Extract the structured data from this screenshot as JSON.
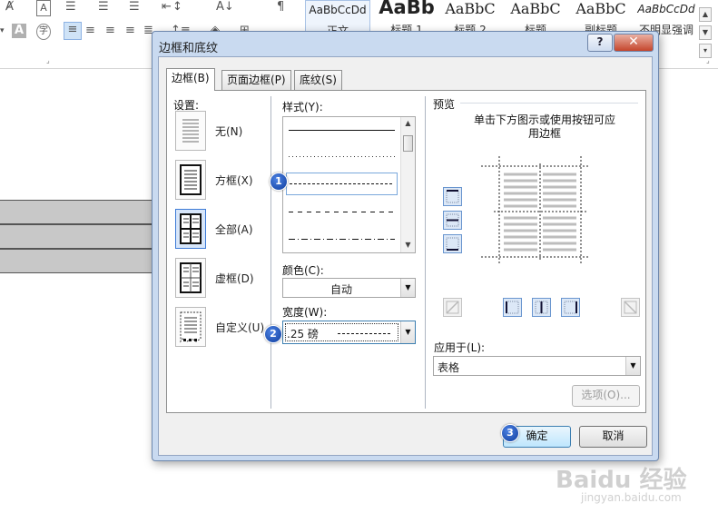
{
  "ribbon": {
    "styles": [
      {
        "sample": "AaBbCcDd",
        "name": "正文"
      },
      {
        "sample": "AaBb",
        "name": "标题 1"
      },
      {
        "sample": "AaBbC",
        "name": "标题 2"
      },
      {
        "sample": "AaBbC",
        "name": "标题"
      },
      {
        "sample": "AaBbC",
        "name": "副标题"
      },
      {
        "sample": "AaBbCcDd",
        "name": "不明显强调"
      }
    ]
  },
  "dialog": {
    "title": "边框和底纹",
    "help_label": "?",
    "close_label": "✕",
    "tabs": [
      {
        "label": "边框(B)",
        "active": true
      },
      {
        "label": "页面边框(P)",
        "active": false
      },
      {
        "label": "底纹(S)",
        "active": false
      }
    ],
    "settings": {
      "label": "设置:",
      "options": [
        {
          "label": "无(N)",
          "icon": "border-none-icon",
          "selected": false
        },
        {
          "label": "方框(X)",
          "icon": "border-box-icon",
          "selected": false
        },
        {
          "label": "全部(A)",
          "icon": "border-all-icon",
          "selected": true
        },
        {
          "label": "虚框(D)",
          "icon": "border-grid-icon",
          "selected": false
        },
        {
          "label": "自定义(U)",
          "icon": "border-custom-icon",
          "selected": false
        }
      ]
    },
    "style": {
      "label": "样式(Y):",
      "selected": "dashed"
    },
    "color": {
      "label": "颜色(C):",
      "value": "自动"
    },
    "width": {
      "label": "宽度(W):",
      "value": ".25 磅"
    },
    "preview": {
      "label": "预览",
      "hint": "单击下方图示或使用按钮可应用边框"
    },
    "apply_to": {
      "label": "应用于(L):",
      "value": "表格"
    },
    "options_button": "选项(O)...",
    "ok_button": "确定",
    "cancel_button": "取消"
  },
  "badges": [
    "1",
    "2",
    "3"
  ],
  "watermark": {
    "logo": "Baidu 经验",
    "url": "jingyan.baidu.com"
  },
  "colors": {
    "dialog_frame": "#c9daf0",
    "badge": "#1c4fbf",
    "close_button": "#c5452c",
    "selected_setting": "#d7e6fa"
  }
}
